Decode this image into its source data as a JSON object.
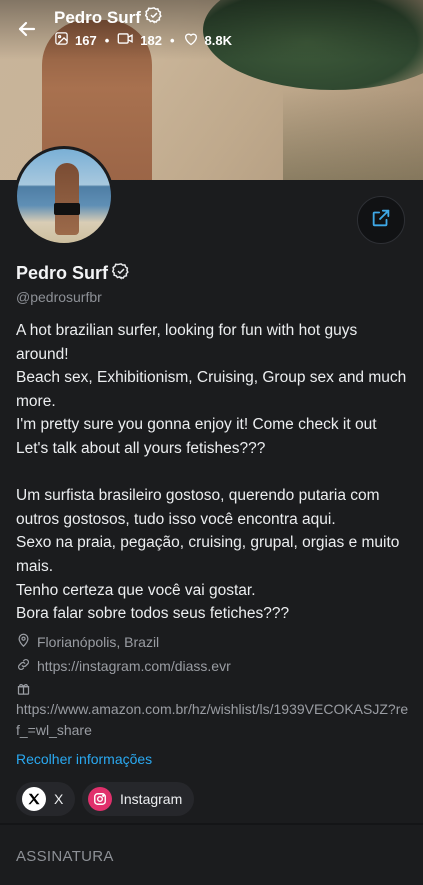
{
  "header": {
    "title": "Pedro Surf",
    "stats": {
      "photos": "167",
      "videos": "182",
      "likes": "8.8K"
    }
  },
  "profile": {
    "name": "Pedro Surf",
    "handle": "@pedrosurfbr",
    "bio": "A hot brazilian surfer, looking for fun with hot guys around!\nBeach sex, Exhibitionism, Cruising, Group sex and much more.\nI'm pretty sure you gonna enjoy it! Come check it out\nLet's talk about all yours fetishes???\n\nUm surfista brasileiro gostoso, querendo putaria com outros gostosos, tudo isso você encontra aqui.\nSexo na praia, pegação, cruising, grupal, orgias e muito mais.\nTenho certeza que você vai gostar.\nBora falar sobre todos seus fetiches???",
    "location": "Florianópolis, Brazil",
    "link": "https://instagram.com/diass.evr",
    "wishlist": "https://www.amazon.com.br/hz/wishlist/ls/1939VECOKASJZ?ref_=wl_share",
    "collapse_label": "Recolher informações"
  },
  "socials": [
    {
      "label": "X",
      "icon": "x-logo-icon"
    },
    {
      "label": "Instagram",
      "icon": "instagram-icon"
    }
  ],
  "section_title": "ASSINATURA",
  "colors": {
    "background": "#1b1c1e",
    "accent_link": "#2aa9f1",
    "share_icon": "#3fa9e8",
    "instagram": "#e1306c"
  }
}
